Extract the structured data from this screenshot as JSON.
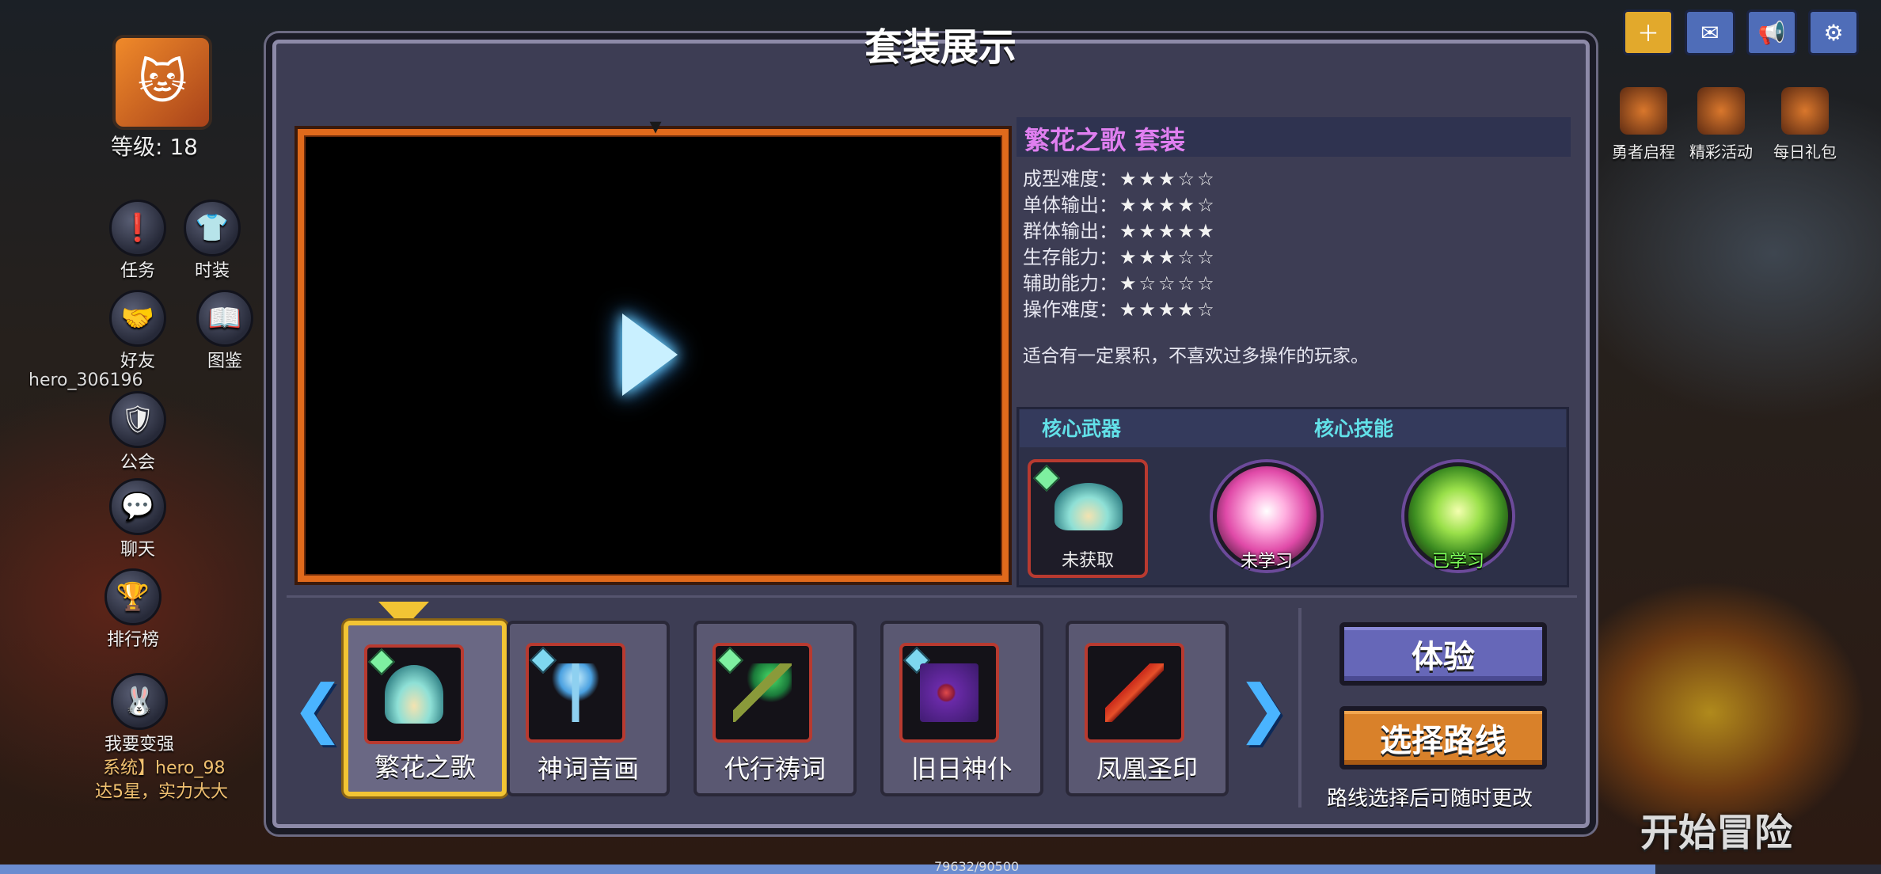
{
  "dialog": {
    "title": "套装展示",
    "set_name": "繁花之歌 套装",
    "stats": [
      {
        "label": "成型难度：",
        "stars": "★★★☆☆",
        "rating": 3
      },
      {
        "label": "单体输出：",
        "stars": "★★★★☆",
        "rating": 4
      },
      {
        "label": "群体输出：",
        "stars": "★★★★★",
        "rating": 5
      },
      {
        "label": "生存能力：",
        "stars": "★★★☆☆",
        "rating": 3
      },
      {
        "label": "辅助能力：",
        "stars": "★☆☆☆☆",
        "rating": 1
      },
      {
        "label": "操作难度：",
        "stars": "★★★★☆",
        "rating": 4
      }
    ],
    "description": "适合有一定累积，不喜欢过多操作的玩家。",
    "core": {
      "weapon_header": "核心武器",
      "skill_header": "核心技能",
      "weapon_status": "未获取",
      "skills": [
        {
          "status": "未学习",
          "status_color": "#ffffff"
        },
        {
          "status": "已学习",
          "status_color": "#7dff5a"
        }
      ]
    },
    "sets": [
      {
        "label": "繁花之歌",
        "selected": true
      },
      {
        "label": "神词音画",
        "selected": false
      },
      {
        "label": "代行祷词",
        "selected": false
      },
      {
        "label": "旧日神仆",
        "selected": false
      },
      {
        "label": "凤凰圣印",
        "selected": false
      }
    ],
    "try_button": "体验",
    "route_button": "选择路线",
    "route_note": "路线选择后可随时更改",
    "prev_icon": "chevron-left-icon",
    "next_icon": "chevron-right-icon",
    "play_icon": "play-icon"
  },
  "background": {
    "level": "等级: 18",
    "player_name": "hero_306196",
    "left_menu": [
      "任务",
      "时装",
      "好友",
      "图鉴",
      "公会",
      "聊天",
      "排行榜",
      "我要变强"
    ],
    "events": [
      "勇者启程",
      "精彩活动",
      "每日礼包"
    ],
    "chat_line_1": "系统】hero_98",
    "chat_line_2": "达5星，实力大大",
    "start_adventure": "开始冒险",
    "xp_text": "79632/90500",
    "xp_progress": 0.88
  }
}
